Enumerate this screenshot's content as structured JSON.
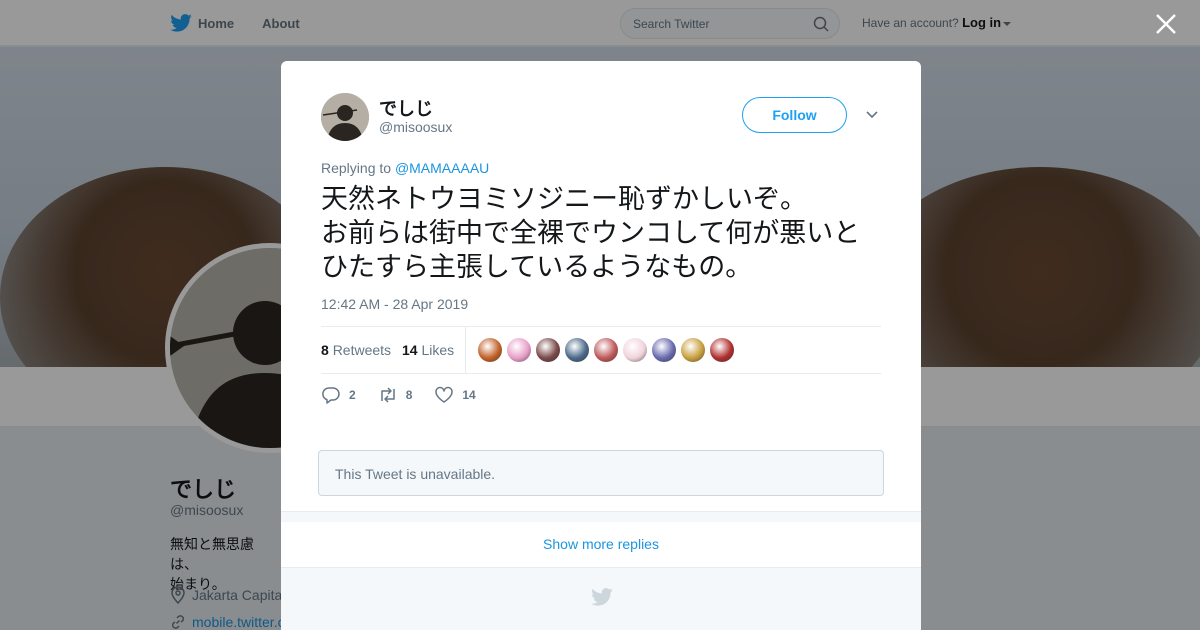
{
  "nav": {
    "home_label": "Home",
    "about_label": "About",
    "search_placeholder": "Search Twitter",
    "account_prompt": "Have an account?",
    "login_label": "Log in"
  },
  "profile": {
    "name": "でしじ",
    "handle": "@misoosux",
    "bio": "無知と無思慮は、\n始まり。",
    "location": "Jakarta Capita",
    "url": "mobile.twitter.c"
  },
  "tweet": {
    "author_name": "でしじ",
    "author_handle": "@misoosux",
    "follow_label": "Follow",
    "replying_prefix": "Replying to",
    "replying_to": "@MAMAAAAU",
    "text": "天然ネトウヨミソジニー恥ずかしいぞ。\nお前らは街中で全裸でウンコして何が悪いと\nひたすら主張しているようなもの。",
    "timestamp": "12:42 AM - 28 Apr 2019",
    "retweet_count": "8",
    "retweet_label": "Retweets",
    "like_count": "14",
    "like_label": "Likes",
    "action_reply_count": "2",
    "action_retweet_count": "8",
    "action_like_count": "14"
  },
  "liker_colors": [
    "#c2622a",
    "#e8a0c8",
    "#7a4a4a",
    "#4c6a8a",
    "#c05a5a",
    "#f0d4dc",
    "#6a6ab0",
    "#c8a040",
    "#b03030"
  ],
  "unavailable_text": "This Tweet is unavailable.",
  "show_more_label": "Show more replies",
  "colors": {
    "accent": "#1da1f2",
    "link": "#1b95e0",
    "muted": "#657786"
  }
}
